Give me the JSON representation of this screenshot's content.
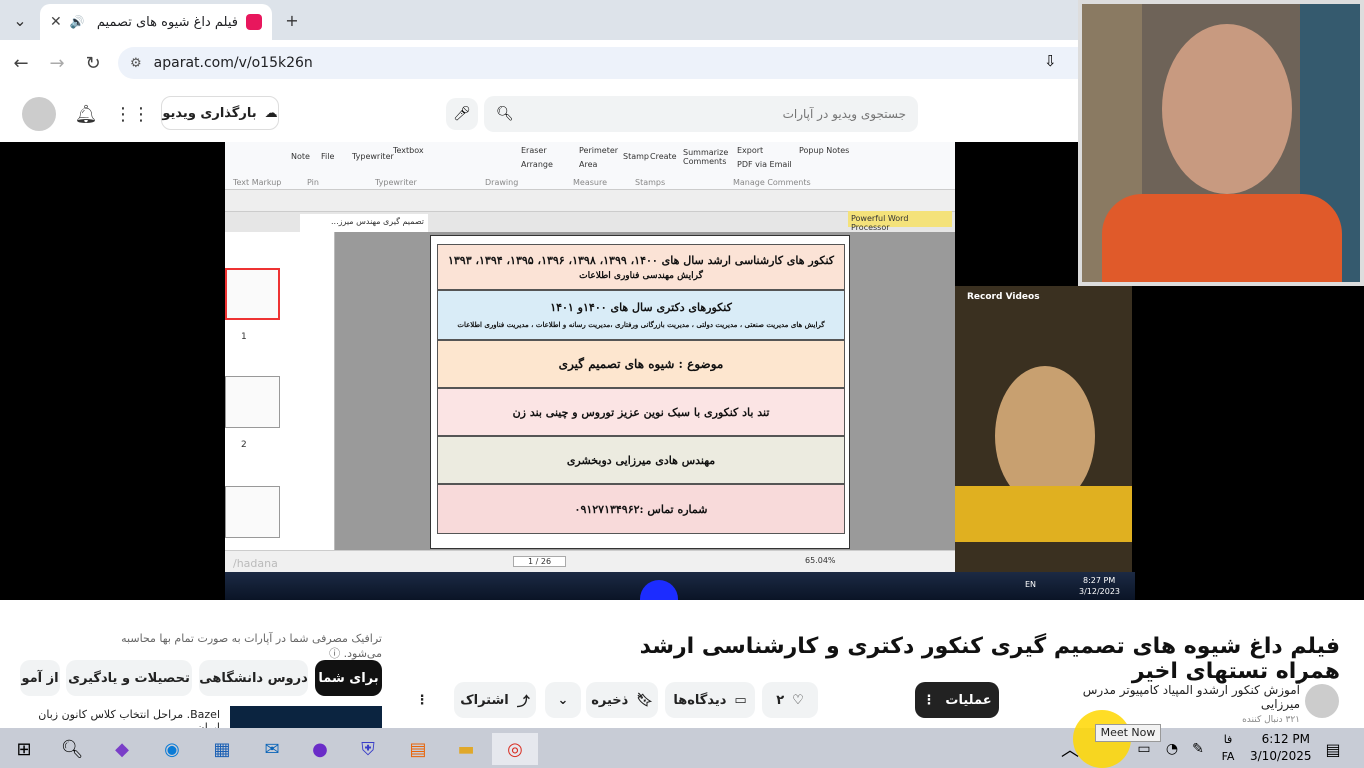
{
  "browser": {
    "tab_title": "فیلم داغ شیوه های تصمیم گ",
    "url": "aparat.com/v/o15k26n",
    "close_glyph": "✕",
    "newtab_glyph": "+",
    "back_glyph": "←",
    "forward_glyph": "→",
    "reload_glyph": "↻"
  },
  "header": {
    "search_placeholder": "جستجوی ویدیو در آپارات",
    "upload_label": "بارگذاری ویدیو"
  },
  "video_screen": {
    "ribbon": {
      "note": "Note",
      "file": "File",
      "typewriter": "Typewriter",
      "textbox": "Textbox",
      "eraser": "Eraser",
      "arrange": "Arrange",
      "perimeter": "Perimeter",
      "area": "Area",
      "stamp": "Stamp",
      "create": "Create",
      "summarize": "Summarize Comments",
      "export": "Export",
      "pdf_email": "PDF via Email",
      "popup_notes": "Popup Notes",
      "text_markup": "Text Markup",
      "pin": "Pin",
      "typewriter_group": "Typewriter",
      "drawing": "Drawing",
      "measure": "Measure",
      "stamps": "Stamps",
      "manage_comments": "Manage Comments"
    },
    "doc_tab": "تصمیم گیری مهندس میرز...",
    "powerful": "Powerful Word Processor",
    "thumb_numbers": [
      "1",
      "2"
    ],
    "page_rows": [
      {
        "line1": "کنکور های کارشناسی ارشد سال های ۱۴۰۰، ۱۳۹۹، ۱۳۹۸، ۱۳۹۶، ۱۳۹۵، ۱۳۹۴، ۱۳۹۳",
        "line2": "گرایش مهندسی فناوری اطلاعات"
      },
      {
        "line1": "کنکورهای دکتری سال های ۱۴۰۰و ۱۴۰۱",
        "line2": "گرایش های مدیریت صنعتی ، مدیریت دولتی ، مدیریت بازرگانی ورفتاری ،مدیریت رسانه و اطلاعات ، مدیریت فناوری اطلاعات"
      },
      {
        "line1": "موضوع : شیوه های تصمیم گیری",
        "line2": ""
      },
      {
        "line1": "تند باد کنکوری با سبک نوین عزیز توروس و چینی بند زن",
        "line2": ""
      },
      {
        "line1": "مهندس هادی میرزایی دوبخشری",
        "line2": ""
      },
      {
        "line1": "شماره تماس :۰۹۱۲۷۱۳۴۹۶۲",
        "line2": ""
      }
    ],
    "page_indicator": "1 / 26",
    "zoom": "65.04%",
    "watermark": "/hadana",
    "record_videos": "Record Videos",
    "inner_lang": "EN",
    "inner_time": "8:27 PM",
    "inner_date": "3/12/2023"
  },
  "video": {
    "title": "فیلم داغ شیوه های تصمیم گیری کنکور دکتری و کارشناسی ارشد همراه تستهای اخیر",
    "traffic_note": "ترافیک مصرفی شما در آپارات به صورت تمام بها محاسبه می‌شود.",
    "operations": "عملیات",
    "likes": "۲",
    "comments": "دیدگاه‌ها",
    "save": "ذخیره",
    "share": "اشتراک",
    "channel_name": "آموزش کنکور ارشدو المپیاد کامپیوتر مدرس میرزایی",
    "channel_subs": "۳۲۱ دنبال کننده",
    "chips": [
      "برای شما",
      "دروس دانشگاهی",
      "تحصیلات و یادگیری",
      "از آمو"
    ],
    "suggest_title": "Bazel. مراحل انتخاب کلاس کانون زبان ایران"
  },
  "taskbar": {
    "meet_now": "Meet Now",
    "time": "6:12 PM",
    "date": "3/10/2025",
    "lang1": "فا",
    "lang2": "FA"
  },
  "colors": {
    "brand": "#e8175d",
    "row_colors": [
      "#fbe3d6",
      "#d9ecf7",
      "#fde6cf",
      "#fbe4e4",
      "#ecebe0",
      "#f8dada"
    ]
  }
}
